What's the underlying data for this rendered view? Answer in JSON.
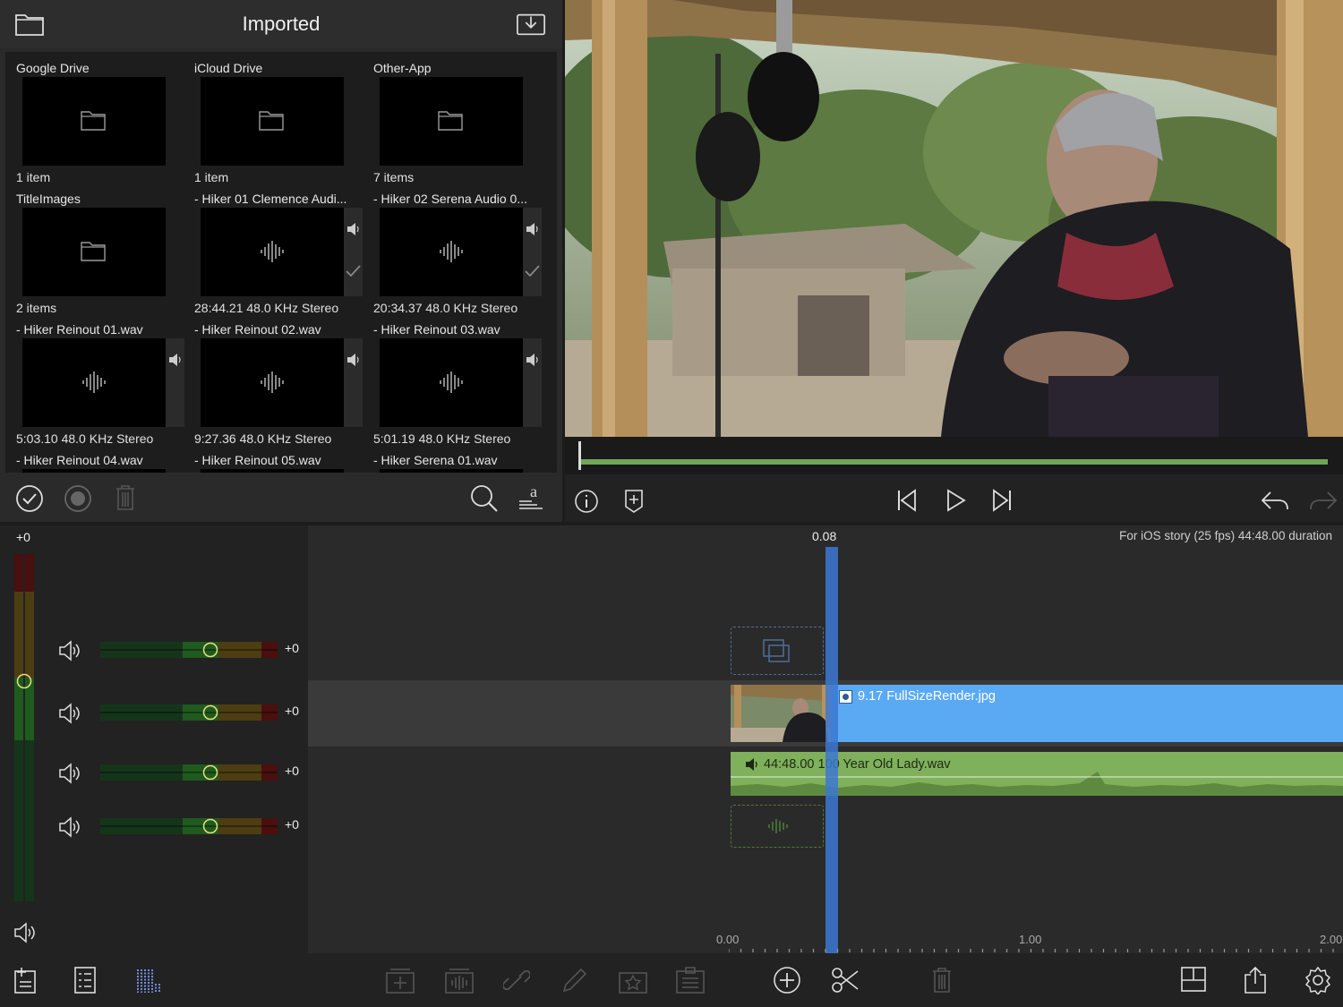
{
  "browser": {
    "title": "Imported",
    "tiles": [
      {
        "name": "Google Drive",
        "meta": "1 item",
        "kind": "folder"
      },
      {
        "name": "iCloud Drive",
        "meta": "1 item",
        "kind": "folder"
      },
      {
        "name": "Other-App",
        "meta": "7 items",
        "kind": "folder"
      },
      {
        "name": "TitleImages",
        "meta": "2 items",
        "kind": "folder"
      },
      {
        "name": "- Hiker 01 Clemence Audi...",
        "meta": "28:44.21  48.0 KHz  Stereo",
        "kind": "audio",
        "used": true
      },
      {
        "name": "- Hiker 02 Serena Audio 0...",
        "meta": "20:34.37  48.0 KHz  Stereo",
        "kind": "audio",
        "used": true
      },
      {
        "name": "- Hiker Reinout 01.wav",
        "meta": "5:03.10  48.0 KHz  Stereo",
        "kind": "audio"
      },
      {
        "name": "- Hiker Reinout 02.wav",
        "meta": "9:27.36  48.0 KHz  Stereo",
        "kind": "audio"
      },
      {
        "name": "- Hiker Reinout 03.wav",
        "meta": "5:01.19  48.0 KHz  Stereo",
        "kind": "audio"
      },
      {
        "name": "- Hiker Reinout 04.wav",
        "meta": "",
        "kind": "audio"
      },
      {
        "name": "- Hiker Reinout 05.wav",
        "meta": "",
        "kind": "audio"
      },
      {
        "name": "- Hiker Serena 01.wav",
        "meta": "",
        "kind": "audio"
      }
    ]
  },
  "viewer": {
    "scrub_progress": 0.0
  },
  "mixer": {
    "master_db": "+0",
    "tracks": [
      {
        "db": "+0",
        "level": 0.5
      },
      {
        "db": "+0",
        "level": 0.5
      },
      {
        "db": "+0",
        "level": 0.5
      },
      {
        "db": "+0",
        "level": 0.5
      }
    ]
  },
  "timeline": {
    "playhead_time": "0.08",
    "project_info": "For iOS story (25 fps)  44:48.00 duration",
    "video_clip": {
      "label": "9.17   FullSizeRender.jpg"
    },
    "audio_clip": {
      "label": "44:48.00   100 Year Old Lady.wav"
    },
    "ruler": [
      "0.00",
      "1.00",
      "2.00"
    ]
  },
  "colors": {
    "accent_blue": "#5aa9f3",
    "audio_green": "#7fb05b",
    "playhead": "#3c78d2"
  }
}
